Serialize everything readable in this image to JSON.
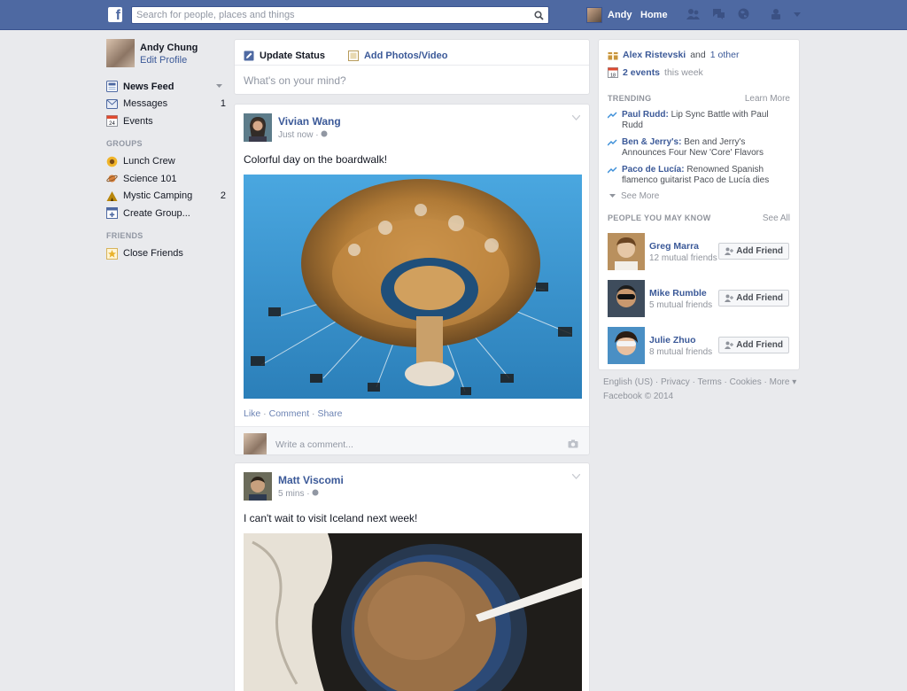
{
  "topbar": {
    "logo": "f",
    "search_placeholder": "Search for people, places and things",
    "user_name": "Andy",
    "home_label": "Home"
  },
  "left": {
    "profile": {
      "name": "Andy Chung",
      "edit_label": "Edit Profile"
    },
    "nav": [
      {
        "label": "News Feed",
        "count": "",
        "icon": "news-feed-icon",
        "active": true
      },
      {
        "label": "Messages",
        "count": "1",
        "icon": "messages-icon"
      },
      {
        "label": "Events",
        "count": "",
        "icon": "events-icon"
      }
    ],
    "groups_header": "GROUPS",
    "groups": [
      {
        "label": "Lunch Crew",
        "count": "",
        "icon": "sunflower-icon"
      },
      {
        "label": "Science 101",
        "count": "",
        "icon": "planet-icon"
      },
      {
        "label": "Mystic Camping",
        "count": "2",
        "icon": "camping-icon"
      },
      {
        "label": "Create Group...",
        "count": "",
        "icon": "create-group-icon"
      }
    ],
    "friends_header": "FRIENDS",
    "friends": [
      {
        "label": "Close Friends",
        "count": "",
        "icon": "star-icon"
      }
    ]
  },
  "composer": {
    "update_status": "Update Status",
    "add_photos": "Add Photos/Video",
    "placeholder": "What's on your mind?"
  },
  "posts": [
    {
      "author": "Vivian Wang",
      "time": "Just now",
      "text": "Colorful day on the boardwalk!",
      "actions": [
        "Like",
        "Comment",
        "Share"
      ],
      "comment_placeholder": "Write a comment..."
    },
    {
      "author": "Matt Viscomi",
      "time": "5 mins",
      "text": "I can't wait to visit Iceland next week!"
    }
  ],
  "right": {
    "birthdays": {
      "name": "Alex Ristevski",
      "rest": "and",
      "other": "1 other"
    },
    "events": {
      "count": "2 events",
      "rest": "this week"
    },
    "trending_header": "TRENDING",
    "learn_more": "Learn More",
    "trending": [
      {
        "name": "Paul Rudd:",
        "desc": "Lip Sync Battle with Paul Rudd"
      },
      {
        "name": "Ben & Jerry's:",
        "desc": "Ben and Jerry's Announces Four New 'Core' Flavors"
      },
      {
        "name": "Paco de Lucía:",
        "desc": "Renowned Spanish flamenco guitarist Paco de Lucía dies"
      }
    ],
    "see_more": "See More",
    "pymk_header": "PEOPLE YOU MAY KNOW",
    "see_all": "See All",
    "people": [
      {
        "name": "Greg Marra",
        "mutual": "12 mutual friends",
        "button": "Add Friend"
      },
      {
        "name": "Mike Rumble",
        "mutual": "5 mutual friends",
        "button": "Add Friend"
      },
      {
        "name": "Julie Zhuo",
        "mutual": "8 mutual friends",
        "button": "Add Friend"
      }
    ]
  },
  "footer": {
    "links": "English (US) · Privacy · Terms · Cookies · More ▾",
    "copyright": "Facebook © 2014"
  },
  "colors": {
    "topbar": "#4e69a2",
    "link": "#3b5998",
    "background": "#e9eaed"
  }
}
